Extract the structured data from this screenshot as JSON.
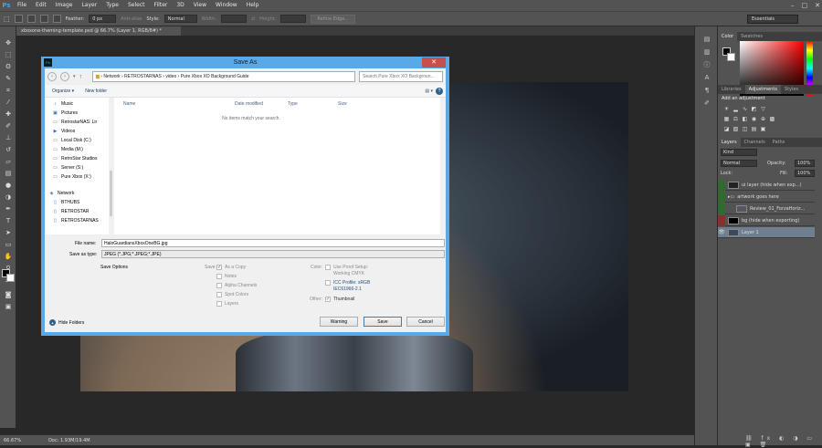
{
  "app": {
    "logo": "Ps"
  },
  "menu": [
    "File",
    "Edit",
    "Image",
    "Layer",
    "Type",
    "Select",
    "Filter",
    "3D",
    "View",
    "Window",
    "Help"
  ],
  "options": {
    "feather_label": "Feather:",
    "feather_value": "0 px",
    "antialias": "Anti-alias",
    "style_label": "Style:",
    "style_value": "Normal",
    "width_label": "Width:",
    "height_label": "Height:",
    "refine_edge": "Refine Edge...",
    "workspace": "Essentials"
  },
  "document": {
    "tab_title": "xboxone-theming-template.psd @ 66.7% (Layer 1, RGB/8#) *",
    "zoom": "66.67%",
    "doc_size": "Doc: 1.93M/19.4M"
  },
  "panels": {
    "color_tabs": [
      "Color",
      "Swatches"
    ],
    "adj_tabs": [
      "Libraries",
      "Adjustments",
      "Styles"
    ],
    "adj_title": "Add an adjustment",
    "layer_tabs": [
      "Layers",
      "Channels",
      "Paths"
    ],
    "kind": "Kind",
    "blend_mode": "Normal",
    "opacity_label": "Opacity:",
    "opacity_value": "100%",
    "lock_label": "Lock:",
    "fill_label": "Fill:",
    "fill_value": "100%",
    "layers": [
      {
        "name": "ui layer (hide when exp...)"
      },
      {
        "name": "artwork goes here"
      },
      {
        "name": "Review_01_ForzaHoriz..."
      },
      {
        "name": "bg (hide when exporting)"
      },
      {
        "name": "Layer 1"
      }
    ]
  },
  "dialog": {
    "title": "Save As",
    "close": "✕",
    "breadcrumb": [
      "Network",
      "RETROSTARNAS",
      "video",
      "Pure Xbox XO Background Guide"
    ],
    "search_placeholder": "Search Pure Xbox XO Backgroun...",
    "organize": "Organize ▾",
    "new_folder": "New folder",
    "sidebar": [
      {
        "icon": "music-icon",
        "glyph": "♪",
        "label": "Music"
      },
      {
        "icon": "pictures-icon",
        "glyph": "▣",
        "label": "Pictures"
      },
      {
        "icon": "network-drive-icon",
        "glyph": "▭",
        "label": "RetrostarNAS: Lir"
      },
      {
        "icon": "videos-icon",
        "glyph": "▶",
        "label": "Videos"
      },
      {
        "icon": "local-disk-icon",
        "glyph": "▭",
        "label": "Local Disk (C:)"
      },
      {
        "icon": "network-drive-icon",
        "glyph": "▭",
        "label": "Media (M:)"
      },
      {
        "icon": "network-drive-icon",
        "glyph": "▭",
        "label": "RetroStar Studios"
      },
      {
        "icon": "network-drive-icon",
        "glyph": "▭",
        "label": "Server (S:)"
      },
      {
        "icon": "network-drive-icon",
        "glyph": "▭",
        "label": "Pure Xbox (X:)"
      },
      {
        "icon": "network-icon",
        "glyph": "◈",
        "label": "Network"
      },
      {
        "icon": "computer-icon",
        "glyph": "▯",
        "label": "BTHUBS"
      },
      {
        "icon": "computer-icon",
        "glyph": "▯",
        "label": "RETROSTAR"
      },
      {
        "icon": "computer-icon",
        "glyph": "▯",
        "label": "RETROSTARNAS"
      }
    ],
    "columns": [
      "Name",
      "Date modified",
      "Type",
      "Size"
    ],
    "empty_message": "No items match your search.",
    "file_name_label": "File name:",
    "file_name": "HaloGuardiansXboxOneBG.jpg",
    "save_type_label": "Save as type:",
    "save_type": "JPEG (*.JPG;*.JPEG;*.JPE)",
    "save_options": "Save Options",
    "save_label": "Save:",
    "as_copy": "As a Copy",
    "notes": "Notes",
    "alpha": "Alpha Channels",
    "spot": "Spot Colors",
    "layers": "Layers",
    "color_label": "Color:",
    "proof": "Use Proof Setup:",
    "proof_sub": "Working CMYK",
    "icc": "ICC Profile: sRGB",
    "icc_sub": "IEC61966-2.1",
    "other_label": "Other:",
    "thumbnail": "Thumbnail",
    "warning": "Warning",
    "save": "Save",
    "cancel": "Cancel",
    "hide_folders": "Hide Folders"
  }
}
